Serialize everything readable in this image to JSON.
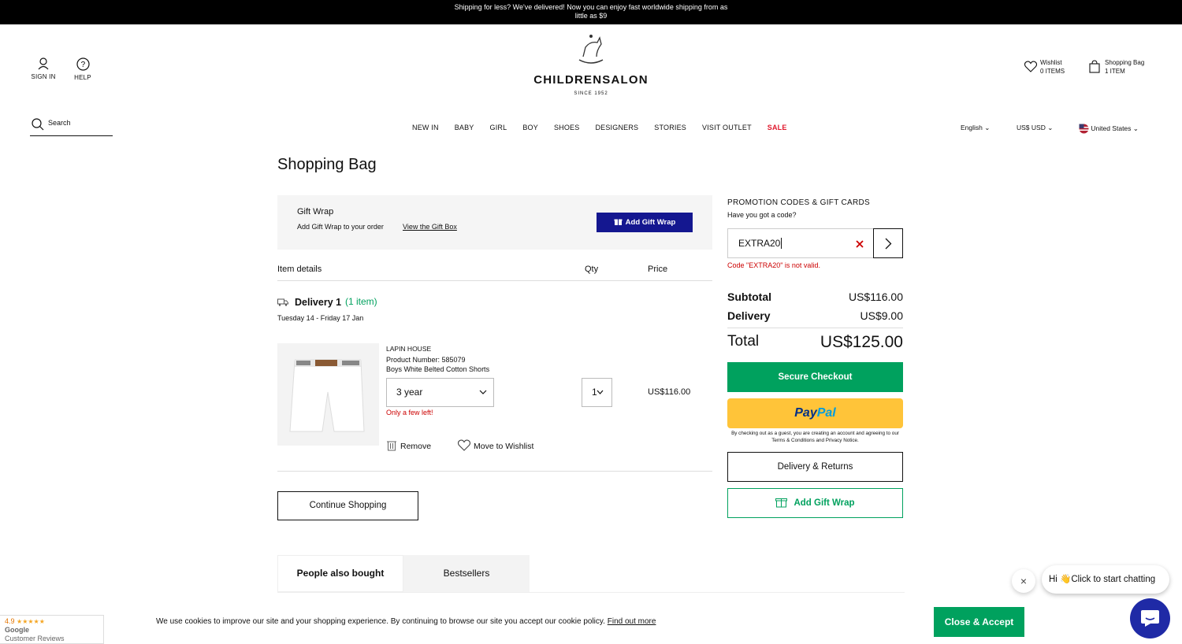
{
  "banner": {
    "text": "Shipping for less? We've delivered! Now you can enjoy fast worldwide shipping from as little as $9"
  },
  "header": {
    "sign_in": "SIGN IN",
    "help": "HELP",
    "logo": "CHILDRENSALON",
    "since": "SINCE 1952",
    "wishlist_label": "Wishlist",
    "wishlist_count": "0 ITEMS",
    "bag_label": "Shopping Bag",
    "bag_count": "1 ITEM",
    "search_placeholder": "Search",
    "language": "English",
    "currency": "US$ USD",
    "country": "United States"
  },
  "nav": [
    "NEW IN",
    "BABY",
    "GIRL",
    "BOY",
    "SHOES",
    "DESIGNERS",
    "STORIES",
    "VISIT OUTLET",
    "SALE"
  ],
  "colors": {
    "sale": "#e0182d",
    "green": "#00a15e",
    "blue": "#141790",
    "delivery_green": "#00a15e",
    "error": "#cc0000"
  },
  "page": {
    "title": "Shopping Bag"
  },
  "gift_wrap": {
    "title": "Gift Wrap",
    "desc": "Add Gift Wrap to your order",
    "link": "View the Gift Box",
    "button": "Add Gift Wrap"
  },
  "table": {
    "item_details": "Item details",
    "qty": "Qty",
    "price": "Price"
  },
  "delivery": {
    "label": "Delivery 1",
    "count": "(1 item)",
    "dates": "Tuesday 14 - Friday 17 Jan"
  },
  "item": {
    "brand": "LAPIN HOUSE",
    "product_number": "Product Number: 585079",
    "name": "Boys White Belted Cotton Shorts",
    "size": "3 year",
    "stock": "Only a few left!",
    "qty": "1",
    "price": "US$116.00",
    "remove": "Remove",
    "move_to_wishlist": "Move to Wishlist"
  },
  "continue_shopping": "Continue Shopping",
  "promo": {
    "heading": "PROMOTION CODES & GIFT CARDS",
    "sub": "Have you got a code?",
    "value": "EXTRA20",
    "error": "Code \"EXTRA20\" is not valid."
  },
  "summary": {
    "subtotal_label": "Subtotal",
    "subtotal": "US$116.00",
    "delivery_label": "Delivery",
    "delivery": "US$9.00",
    "total_label": "Total",
    "total": "US$125.00"
  },
  "checkout": {
    "secure": "Secure Checkout",
    "paypal_a": "Pay",
    "paypal_b": "Pal",
    "fine_print": "By checking out as a guest, you are creating an account and agreeing to our Terms & Conditions and Privacy Notice.",
    "delivery_returns": "Delivery & Returns",
    "add_gift_wrap": "Add Gift Wrap"
  },
  "tabs": [
    "People also bought",
    "Bestsellers"
  ],
  "cookie": {
    "text": "We use cookies to improve our site and your shopping experience. By continuing to browse our site you accept our cookie policy.",
    "link": "Find out more",
    "button": "Close & Accept"
  },
  "google": {
    "rating": "4.9",
    "stars": "★★★★★",
    "brand": "Google",
    "label": "Customer Reviews"
  },
  "chat": {
    "message": "Hi 👋Click to start chatting",
    "close": "×"
  }
}
